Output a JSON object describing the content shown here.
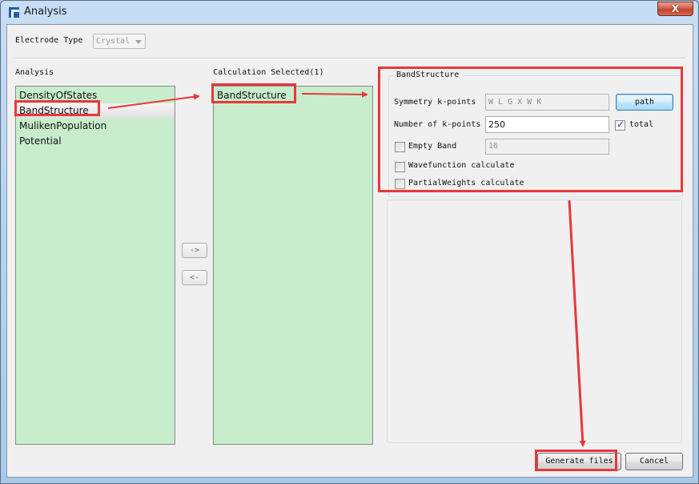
{
  "window": {
    "title": "Analysis",
    "close_label": "X"
  },
  "electrode": {
    "label": "Electrode Type",
    "value": "Crystal"
  },
  "analysis": {
    "label": "Analysis",
    "items": [
      "DensityOfStates",
      "BandStructure",
      "MulikenPopulation",
      "Potential"
    ],
    "selected_index": 1
  },
  "transfer": {
    "add_label": "->",
    "remove_label": "<-"
  },
  "calculation": {
    "label": "Calculation Selected(1)",
    "items": [
      "BandStructure"
    ]
  },
  "band_structure": {
    "group_title": "BandStructure",
    "symmetry_label": "Symmetry k-points",
    "symmetry_value": "W L G X W K",
    "path_button": "path",
    "kpoints_label": "Number of k-points",
    "kpoints_value": "250",
    "total_label": "total",
    "total_checked": true,
    "empty_band_label": "Empty Band",
    "empty_band_checked": false,
    "empty_band_value": "16",
    "wavefunction_label": "Wavefunction calculate",
    "wavefunction_checked": false,
    "partial_weights_label": "PartialWeights calculate",
    "partial_weights_checked": false
  },
  "footer": {
    "generate_label": "Generate files",
    "cancel_label": "Cancel"
  },
  "annotation": {
    "color": "#e8383a"
  }
}
